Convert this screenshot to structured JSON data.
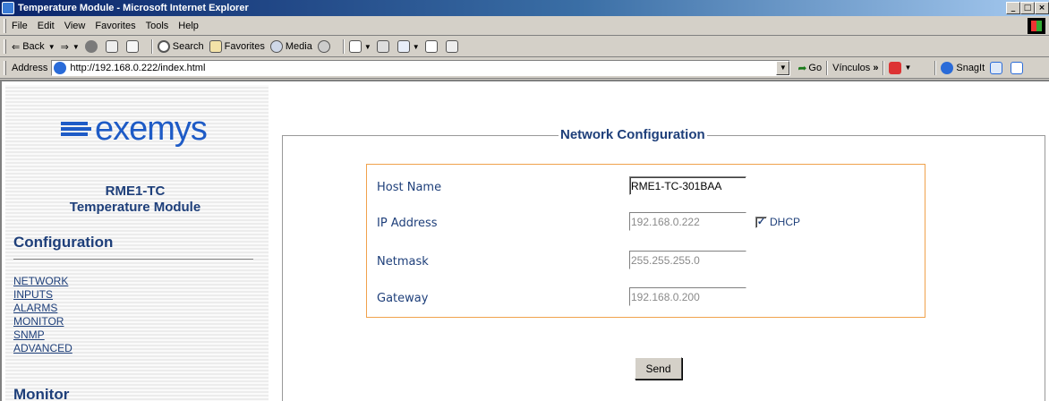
{
  "window": {
    "title": "Temperature Module - Microsoft Internet Explorer",
    "controls": [
      "_",
      "□",
      "×"
    ]
  },
  "menubar": [
    "File",
    "Edit",
    "View",
    "Favorites",
    "Tools",
    "Help"
  ],
  "toolbar": {
    "back": "Back",
    "search": "Search",
    "favorites": "Favorites",
    "media": "Media"
  },
  "addressbar": {
    "label": "Address",
    "url": "http://192.168.0.222/index.html",
    "go": "Go",
    "links": "Vínculos",
    "links_chevron": "»",
    "snagit": "SnagIt"
  },
  "sidebar": {
    "logo": "exemys",
    "model": "RME1-TC",
    "module": "Temperature Module",
    "config_heading": "Configuration",
    "links": [
      "NETWORK",
      "INPUTS",
      "ALARMS",
      "MONITOR",
      "SNMP",
      "ADVANCED"
    ],
    "monitor_heading": "Monitor"
  },
  "form": {
    "legend": "Network Configuration",
    "host_label": "Host Name",
    "host_value": "RME1-TC-301BAA",
    "ip_label": "IP Address",
    "ip_value": "192.168.0.222",
    "dhcp_label": "DHCP",
    "dhcp_checked": true,
    "netmask_label": "Netmask",
    "netmask_value": "255.255.255.0",
    "gateway_label": "Gateway",
    "gateway_value": "192.168.0.200",
    "send_label": "Send"
  },
  "colors": {
    "title_bar": "#0a246a",
    "brand_blue": "#1e5bc6",
    "text_navy": "#1e3f7a",
    "form_border": "#f0a24c",
    "chrome": "#d4d0c8"
  }
}
